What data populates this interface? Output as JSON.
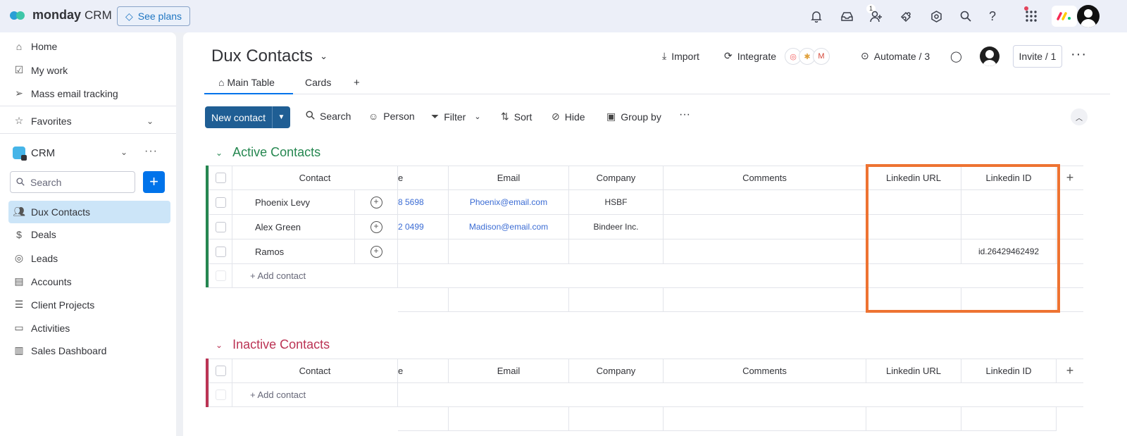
{
  "topbar": {
    "brand": "monday",
    "brand_sub": "CRM",
    "see_plans": "See plans",
    "inbox_badge": "1",
    "icons": [
      "bell-icon",
      "inbox-icon",
      "invite-members-icon",
      "apps-icon",
      "settings-icon",
      "search-icon",
      "help-icon",
      "grid-icon"
    ]
  },
  "sidebar": {
    "home": "Home",
    "my_work": "My work",
    "mass_email": "Mass email tracking",
    "favorites": "Favorites",
    "workspace": "CRM",
    "search_placeholder": "Search",
    "items": [
      "Dux Contacts",
      "Deals",
      "Leads",
      "Accounts",
      "Client Projects",
      "Activities",
      "Sales Dashboard"
    ]
  },
  "board": {
    "title": "Dux Contacts",
    "import": "Import",
    "integrate": "Integrate",
    "automate": "Automate / 3",
    "invite": "Invite / 1",
    "tabs": [
      "Main Table",
      "Cards",
      "+"
    ],
    "new_contact": "New contact",
    "toolbar": [
      "Search",
      "Person",
      "Filter",
      "Sort",
      "Hide",
      "Group by"
    ]
  },
  "columns": [
    "Contact",
    "e",
    "Email",
    "Company",
    "Comments",
    "Linkedin URL",
    "Linkedin ID",
    "+"
  ],
  "active_group": {
    "title": "Active Contacts",
    "color": "#258750",
    "rows": [
      {
        "contact": "Phoenix Levy",
        "phone": "8 5698",
        "email": "Phoenix@email.com",
        "company": "HSBF",
        "linkedin_id": ""
      },
      {
        "contact": "Alex Green",
        "phone": "2 0499",
        "email": "Madison@email.com",
        "company": "Bindeer Inc.",
        "linkedin_id": ""
      },
      {
        "contact": "Ramos",
        "phone": "",
        "email": "",
        "company": "",
        "linkedin_id": "id.26429462492"
      }
    ],
    "add_label": "+ Add contact"
  },
  "inactive_group": {
    "title": "Inactive Contacts",
    "color": "#bb3354",
    "add_label": "+ Add contact"
  },
  "accent_color": "#0073ea",
  "highlight_color": "#ee7332"
}
